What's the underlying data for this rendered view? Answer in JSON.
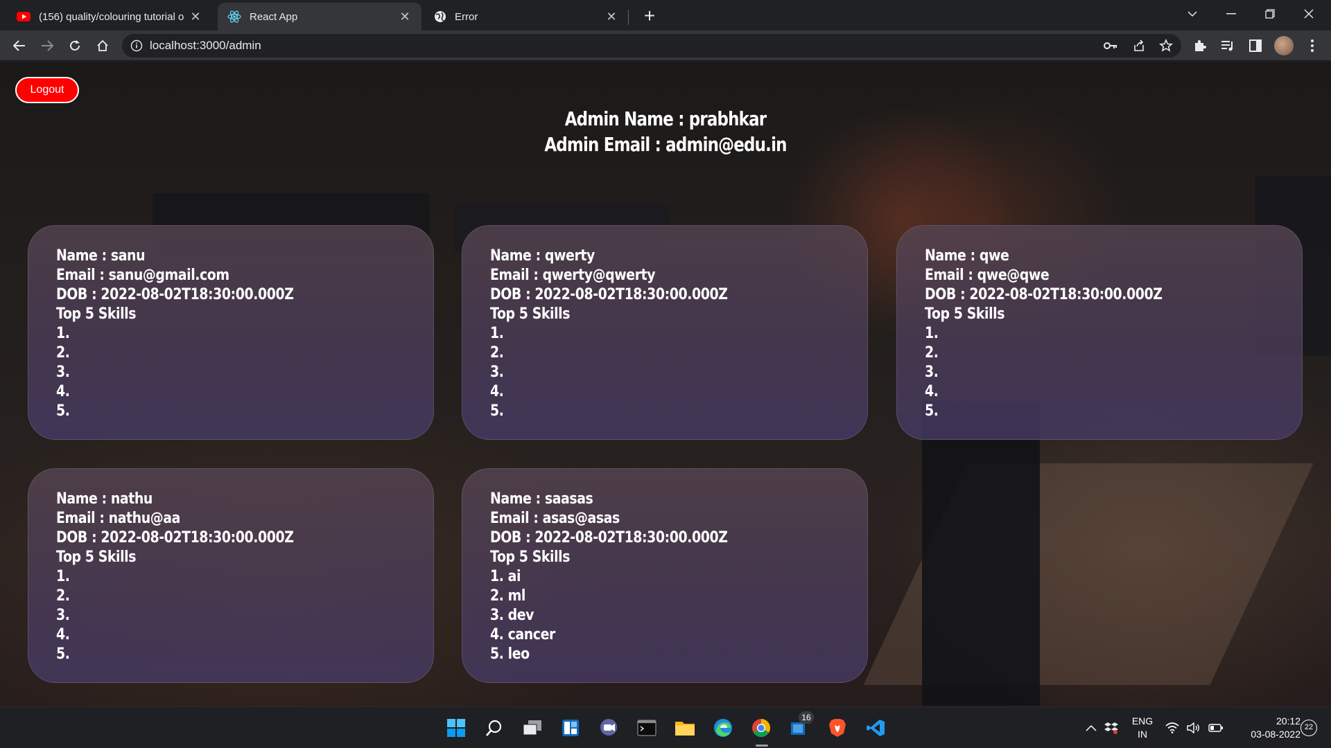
{
  "browser": {
    "tabs": [
      {
        "title": "(156) quality/colouring tutorial o",
        "icon": "youtube-icon"
      },
      {
        "title": "React App",
        "icon": "react-icon"
      },
      {
        "title": "Error",
        "icon": "globe-icon"
      }
    ],
    "url": "localhost:3000/admin"
  },
  "page": {
    "logout_label": "Logout",
    "admin_name": "Admin Name : prabhkar",
    "admin_email": "Admin Email : admin@edu.in",
    "cards": [
      {
        "name": "Name : sanu",
        "email": "Email : sanu@gmail.com",
        "dob": "DOB : 2022-08-02T18:30:00.000Z",
        "skills_title": "Top 5 Skills",
        "skills": [
          "1.",
          "2.",
          "3.",
          "4.",
          "5."
        ]
      },
      {
        "name": "Name : qwerty",
        "email": "Email : qwerty@qwerty",
        "dob": "DOB : 2022-08-02T18:30:00.000Z",
        "skills_title": "Top 5 Skills",
        "skills": [
          "1.",
          "2.",
          "3.",
          "4.",
          "5."
        ]
      },
      {
        "name": "Name : qwe",
        "email": "Email : qwe@qwe",
        "dob": "DOB : 2022-08-02T18:30:00.000Z",
        "skills_title": "Top 5 Skills",
        "skills": [
          "1.",
          "2.",
          "3.",
          "4.",
          "5."
        ]
      },
      {
        "name": "Name : nathu",
        "email": "Email : nathu@aa",
        "dob": "DOB : 2022-08-02T18:30:00.000Z",
        "skills_title": "Top 5 Skills",
        "skills": [
          "1.",
          "2.",
          "3.",
          "4.",
          "5."
        ]
      },
      {
        "name": "Name : saasas",
        "email": "Email : asas@asas",
        "dob": "DOB : 2022-08-02T18:30:00.000Z",
        "skills_title": "Top 5 Skills",
        "skills": [
          "1. ai",
          "2. ml",
          "3. dev",
          "4. cancer",
          "5. leo"
        ]
      }
    ]
  },
  "taskbar": {
    "badge_count": "16",
    "language": "ENG",
    "region": "IN",
    "time": "20:12",
    "date": "03-08-2022",
    "notifications": "22"
  },
  "colors": {
    "logout_bg": "#ff0000",
    "chrome_bg": "#202124",
    "toolbar_bg": "#35363a"
  }
}
